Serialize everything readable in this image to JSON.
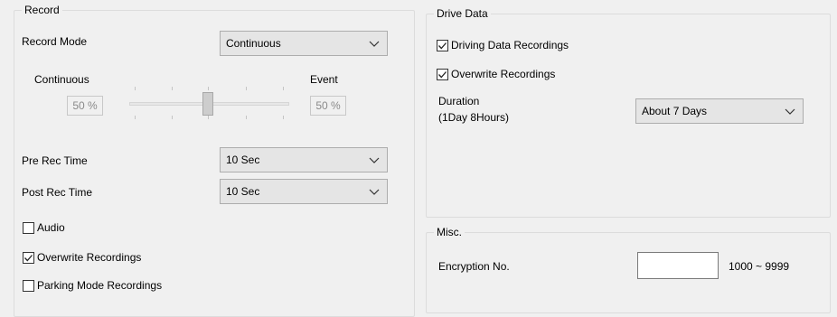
{
  "record": {
    "title": "Record",
    "record_mode_label": "Record Mode",
    "record_mode_value": "Continuous",
    "slider": {
      "left_label": "Continuous",
      "right_label": "Event",
      "left_value": "50 %",
      "right_value": "50 %",
      "position_percent": 50
    },
    "pre_rec_label": "Pre Rec Time",
    "pre_rec_value": "10 Sec",
    "post_rec_label": "Post Rec Time",
    "post_rec_value": "10 Sec",
    "audio": {
      "label": "Audio",
      "checked": false
    },
    "overwrite": {
      "label": "Overwrite Recordings",
      "checked": true
    },
    "parking": {
      "label": "Parking Mode Recordings",
      "checked": false
    }
  },
  "drive_data": {
    "title": "Drive Data",
    "driving_recordings": {
      "label": "Driving Data Recordings",
      "checked": true
    },
    "overwrite": {
      "label": "Overwrite Recordings",
      "checked": true
    },
    "duration_label": "Duration",
    "duration_sub": "(1Day 8Hours)",
    "duration_value": "About 7 Days"
  },
  "misc": {
    "title": "Misc.",
    "encryption_label": "Encryption No.",
    "encryption_value": "",
    "encryption_range": "1000 ~ 9999"
  },
  "icons": {
    "dropdown": "chevron-down-icon",
    "check": "check-icon"
  }
}
